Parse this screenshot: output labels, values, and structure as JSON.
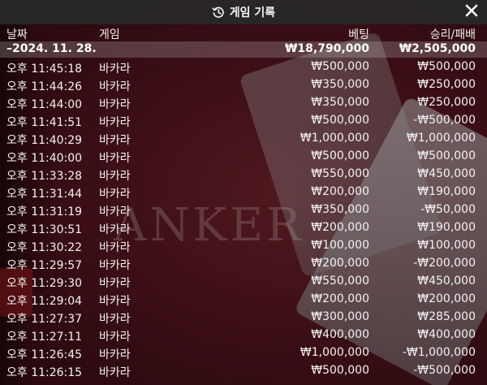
{
  "panel": {
    "title": "게임 기록",
    "icons": {
      "title": "history-icon",
      "close": "close-icon"
    }
  },
  "columns": {
    "date": "날짜",
    "game": "게임",
    "bet": "베팅",
    "result": "승리/패배"
  },
  "summary": {
    "date": "–2024. 11. 28.",
    "bet": "₩18,790,000",
    "result": "₩2,505,000"
  },
  "rows": [
    {
      "time": "오후 11:45:18",
      "game": "바카라",
      "bet": "₩500,000",
      "result": "₩500,000"
    },
    {
      "time": "오후 11:44:26",
      "game": "바카라",
      "bet": "₩350,000",
      "result": "₩250,000"
    },
    {
      "time": "오후 11:44:00",
      "game": "바카라",
      "bet": "₩350,000",
      "result": "₩250,000"
    },
    {
      "time": "오후 11:41:51",
      "game": "바카라",
      "bet": "₩500,000",
      "result": "-₩500,000"
    },
    {
      "time": "오후 11:40:29",
      "game": "바카라",
      "bet": "₩1,000,000",
      "result": "₩1,000,000"
    },
    {
      "time": "오후 11:40:00",
      "game": "바카라",
      "bet": "₩500,000",
      "result": "₩500,000"
    },
    {
      "time": "오후 11:33:28",
      "game": "바카라",
      "bet": "₩550,000",
      "result": "₩450,000"
    },
    {
      "time": "오후 11:31:44",
      "game": "바카라",
      "bet": "₩200,000",
      "result": "₩190,000"
    },
    {
      "time": "오후 11:31:19",
      "game": "바카라",
      "bet": "₩350,000",
      "result": "-₩50,000"
    },
    {
      "time": "오후 11:30:51",
      "game": "바카라",
      "bet": "₩200,000",
      "result": "₩190,000"
    },
    {
      "time": "오후 11:30:22",
      "game": "바카라",
      "bet": "₩100,000",
      "result": "₩100,000"
    },
    {
      "time": "오후 11:29:57",
      "game": "바카라",
      "bet": "₩200,000",
      "result": "-₩200,000"
    },
    {
      "time": "오후 11:29:30",
      "game": "바카라",
      "bet": "₩550,000",
      "result": "₩450,000"
    },
    {
      "time": "오후 11:29:04",
      "game": "바카라",
      "bet": "₩200,000",
      "result": "₩200,000"
    },
    {
      "time": "오후 11:27:37",
      "game": "바카라",
      "bet": "₩300,000",
      "result": "₩285,000"
    },
    {
      "time": "오후 11:27:11",
      "game": "바카라",
      "bet": "₩400,000",
      "result": "₩400,000"
    },
    {
      "time": "오후 11:26:45",
      "game": "바카라",
      "bet": "₩1,000,000",
      "result": "-₩1,000,000"
    },
    {
      "time": "오후 11:26:15",
      "game": "바카라",
      "bet": "₩500,000",
      "result": "-₩500,000"
    }
  ],
  "background": {
    "watermark": "ANKER"
  }
}
